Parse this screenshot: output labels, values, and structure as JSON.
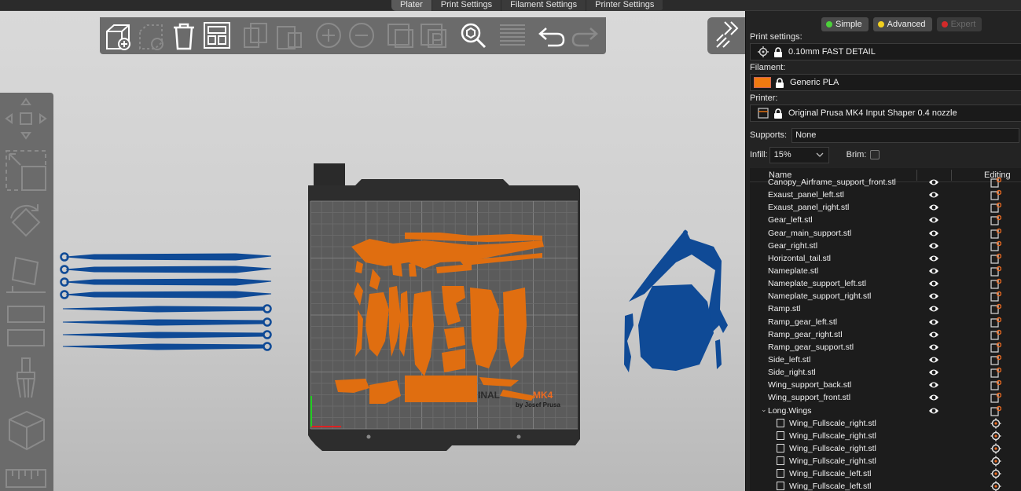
{
  "tabs": [
    "Plater",
    "Print Settings",
    "Filament Settings",
    "Printer Settings"
  ],
  "modes": [
    {
      "label": "Simple",
      "color": "#4cd13a"
    },
    {
      "label": "Advanced",
      "color": "#f2d01f"
    },
    {
      "label": "Expert",
      "color": "#d42a2a"
    }
  ],
  "print_settings": {
    "label": "Print settings:",
    "value": "0.10mm FAST DETAIL"
  },
  "filament": {
    "label": "Filament:",
    "value": "Generic PLA",
    "color": "#f07a10"
  },
  "printer": {
    "label": "Printer:",
    "value": "Original Prusa MK4 Input Shaper 0.4 nozzle"
  },
  "supports": {
    "label": "Supports:",
    "value": "None"
  },
  "infill": {
    "label": "Infill:",
    "value": "15%"
  },
  "brim": {
    "label": "Brim:"
  },
  "object_list": {
    "col_name": "Name",
    "col_editing": "Editing",
    "rows": [
      {
        "label": "Canopy_Airframe_support_front.stl",
        "kind": "top"
      },
      {
        "label": "Exaust_panel_left.stl",
        "kind": "top"
      },
      {
        "label": "Exaust_panel_right.stl",
        "kind": "top"
      },
      {
        "label": "Gear_left.stl",
        "kind": "top"
      },
      {
        "label": "Gear_main_support.stl",
        "kind": "top"
      },
      {
        "label": "Gear_right.stl",
        "kind": "top"
      },
      {
        "label": "Horizontal_tail.stl",
        "kind": "top"
      },
      {
        "label": "Nameplate.stl",
        "kind": "top"
      },
      {
        "label": "Nameplate_support_left.stl",
        "kind": "top"
      },
      {
        "label": "Nameplate_support_right.stl",
        "kind": "top"
      },
      {
        "label": "Ramp.stl",
        "kind": "top"
      },
      {
        "label": "Ramp_gear_left.stl",
        "kind": "top"
      },
      {
        "label": "Ramp_gear_right.stl",
        "kind": "top"
      },
      {
        "label": "Ramp_gear_support.stl",
        "kind": "top"
      },
      {
        "label": "Side_left.stl",
        "kind": "top"
      },
      {
        "label": "Side_right.stl",
        "kind": "top"
      },
      {
        "label": "Wing_support_back.stl",
        "kind": "top"
      },
      {
        "label": "Wing_support_front.stl",
        "kind": "top"
      },
      {
        "label": "Long.Wings",
        "kind": "group"
      },
      {
        "label": "Wing_Fullscale_right.stl",
        "kind": "child"
      },
      {
        "label": "Wing_Fullscale_right.stl",
        "kind": "child"
      },
      {
        "label": "Wing_Fullscale_right.stl",
        "kind": "child"
      },
      {
        "label": "Wing_Fullscale_right.stl",
        "kind": "child"
      },
      {
        "label": "Wing_Fullscale_left.stl",
        "kind": "child"
      },
      {
        "label": "Wing_Fullscale_left.stl",
        "kind": "child"
      }
    ]
  },
  "bed": {
    "brand_text": "INAL",
    "model_text": "MK4",
    "byline": "by Josef Prusa"
  },
  "colors": {
    "accent": "#ed6b21",
    "parts": "#e06e10",
    "outside": "#0f4a96",
    "panel": "#232323"
  }
}
